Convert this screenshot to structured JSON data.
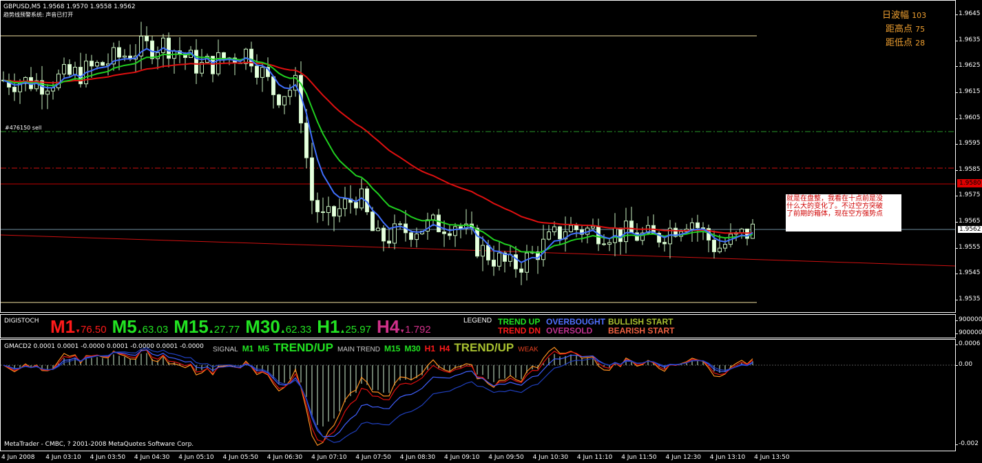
{
  "header": {
    "symbol_line": "GBPUSD,M5  1.9568 1.9570 1.9558 1.9562",
    "status_line": "趋势线预警系统: 声音已打开"
  },
  "stats": [
    {
      "label": "日波幅",
      "value": "103"
    },
    {
      "label": "距高点",
      "value": "75"
    },
    {
      "label": "距低点",
      "value": "28"
    }
  ],
  "order_label": "#476150 sell",
  "note": [
    "就是在盘整，我看在十点前是没",
    "什么大的变化了。不过空方突破",
    "了前期的箱体，现在空方强势点"
  ],
  "price_axis": [
    "1.9645",
    "1.9635",
    "1.9625",
    "1.9615",
    "1.9605",
    "1.9595",
    "1.9585",
    "1.9575",
    "1.9565",
    "1.9555",
    "1.9545",
    "1.9535"
  ],
  "price_marker_red": "1.9580",
  "price_marker_current": "1.9562",
  "price_path": [
    [
      0,
      1.962
    ],
    [
      60,
      1.9619
    ],
    [
      120,
      1.9623
    ],
    [
      200,
      1.9632
    ],
    [
      240,
      1.9634
    ],
    [
      290,
      1.9625
    ],
    [
      360,
      1.9631
    ],
    [
      400,
      1.9614
    ],
    [
      430,
      1.9618
    ],
    [
      440,
      1.96
    ],
    [
      450,
      1.9575
    ],
    [
      470,
      1.9565
    ],
    [
      520,
      1.9576
    ],
    [
      545,
      1.9558
    ],
    [
      600,
      1.9563
    ],
    [
      660,
      1.9565
    ],
    [
      700,
      1.9554
    ],
    [
      740,
      1.9548
    ],
    [
      760,
      1.955
    ],
    [
      820,
      1.9563
    ],
    [
      900,
      1.9561
    ],
    [
      950,
      1.9559
    ],
    [
      1000,
      1.9567
    ],
    [
      1040,
      1.9555
    ],
    [
      1098,
      1.9563
    ]
  ],
  "digistoch": {
    "title": "DIGISTOCH",
    "items": [
      {
        "tf": "M1",
        "arrow": "▼",
        "value": "76.50",
        "color": "#ff1a1a"
      },
      {
        "tf": "M5",
        "arrow": "▲",
        "value": "63.03",
        "color": "#22e322"
      },
      {
        "tf": "M15",
        "arrow": "▲",
        "value": "27.77",
        "color": "#22e322"
      },
      {
        "tf": "M30",
        "arrow": "▲",
        "value": "62.33",
        "color": "#22e322"
      },
      {
        "tf": "H1",
        "arrow": "▲",
        "value": "25.97",
        "color": "#22e322"
      },
      {
        "tf": "H4",
        "arrow": "▼",
        "value": "1.792",
        "color": "#d0308a"
      }
    ],
    "legend": {
      "label": "LEGEND",
      "trend_up": "TREND UP",
      "trend_dn": "TREND DN",
      "overbought": "OVERBOUGHT",
      "oversold": "OVERSOLD",
      "bullish": "BULLISH START",
      "bearish": "BEARISH START"
    },
    "axis": [
      "9000000",
      "9000000"
    ]
  },
  "gmacd": {
    "title": "GMACD2 0.0001 0.0001 -0.0000 0.0001 -0.0000 0.0001 -0.0000",
    "signal": "SIGNAL",
    "m1": "M1",
    "m5": "M5",
    "signal_trend": "TREND/UP",
    "main_trend": "MAIN TREND",
    "m15": "M15",
    "m30": "M30",
    "h1": "H1",
    "h4": "H4",
    "main_trend_value": "TREND/UP",
    "weak": "WEAK",
    "axis": [
      "0.0006",
      "0.00",
      "-0.002"
    ]
  },
  "copyright": "MetaTrader - CMBC, ? 2001-2008 MetaQuotes Software Corp.",
  "time_axis": [
    "4 Jun 2008",
    "4 Jun 03:10",
    "4 Jun 03:50",
    "4 Jun 04:30",
    "4 Jun 05:10",
    "4 Jun 05:50",
    "4 Jun 06:30",
    "4 Jun 07:10",
    "4 Jun 07:50",
    "4 Jun 08:30",
    "4 Jun 09:10",
    "4 Jun 09:50",
    "4 Jun 10:30",
    "4 Jun 11:10",
    "4 Jun 11:50",
    "4 Jun 12:30",
    "4 Jun 13:10",
    "4 Jun 13:50"
  ]
}
